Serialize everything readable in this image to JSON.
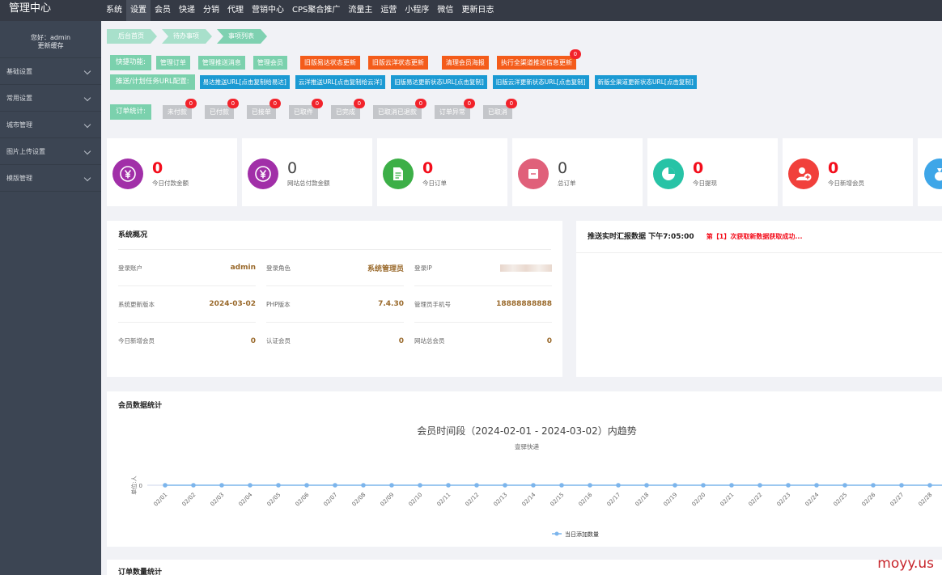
{
  "app": {
    "title": "管理中心"
  },
  "topnav": [
    "系统",
    "设置",
    "会员",
    "快递",
    "分销",
    "代理",
    "营销中心",
    "CPS聚合推广",
    "流量主",
    "运营",
    "小程序",
    "微信",
    "更新日志"
  ],
  "sidebar": {
    "greeting": "您好：admin",
    "refresh_cache": "更新缓存",
    "items": [
      "基础设置",
      "常用设置",
      "城市管理",
      "图片上传设置",
      "模版管理"
    ]
  },
  "breadcrumb": [
    "后台首页",
    "待办事项",
    "事项列表"
  ],
  "quick": {
    "label": "快捷功能:",
    "buttons": [
      "管理订单",
      "管理推送消息",
      "管理会员"
    ],
    "orange_buttons": [
      "旧版易达状态更新",
      "旧版云洋状态更新",
      "清理会员海报",
      "执行全渠道推送信息更新"
    ],
    "last_badge": "0"
  },
  "push_urls": {
    "label": "推送/计划任务URL配置:",
    "buttons": [
      "易达推送URL[点击复制给易达]",
      "云洋推送URL[点击复制给云洋]",
      "旧版易达更新状态URL[点击复制]",
      "旧版云洋更新状态URL[点击复制]",
      "新版全渠道更新状态URL[点击复制]"
    ]
  },
  "orders": {
    "label": "订单统计:",
    "items": [
      {
        "label": "未付款",
        "count": "0"
      },
      {
        "label": "已付款",
        "count": "0"
      },
      {
        "label": "已接单",
        "count": "0"
      },
      {
        "label": "已取件",
        "count": "0"
      },
      {
        "label": "已完成",
        "count": "0"
      },
      {
        "label": "已取消已退款",
        "count": "0"
      },
      {
        "label": "订单异常",
        "count": "0"
      },
      {
        "label": "已取消",
        "count": "0"
      }
    ]
  },
  "stats": [
    {
      "value": "0",
      "label": "今日付款金额",
      "icon": "yen-icon",
      "color": "#a12fa8",
      "red": true
    },
    {
      "value": "0",
      "label": "网站总付款金额",
      "icon": "yen-icon",
      "color": "#a12fa8",
      "red": false
    },
    {
      "value": "0",
      "label": "今日订单",
      "icon": "document-icon",
      "color": "#3caf47",
      "red": true
    },
    {
      "value": "0",
      "label": "总订单",
      "icon": "note-icon",
      "color": "#e0607a",
      "red": false
    },
    {
      "value": "0",
      "label": "今日提现",
      "icon": "pie-icon",
      "color": "#27c3a6",
      "red": true
    },
    {
      "value": "0",
      "label": "今日新增会员",
      "icon": "add-user-icon",
      "color": "#f1403b",
      "red": true
    }
  ],
  "system": {
    "title": "系统概况",
    "rows": [
      [
        {
          "k": "登录账户",
          "v": "admin"
        },
        {
          "k": "登录角色",
          "v": "系统管理员"
        },
        {
          "k": "登录IP",
          "v": ""
        }
      ],
      [
        {
          "k": "系统更新版本",
          "v": "2024-03-02"
        },
        {
          "k": "PHP版本",
          "v": "7.4.30"
        },
        {
          "k": "管理员手机号",
          "v": "18888888888"
        }
      ],
      [
        {
          "k": "今日新增会员",
          "v": "0"
        },
        {
          "k": "认证会员",
          "v": "0"
        },
        {
          "k": "网站总会员",
          "v": "0"
        }
      ]
    ]
  },
  "push_panel": {
    "title": "推送实时汇报数据 下午7:05:00",
    "message": "第【1】次获取新数据获取成功..."
  },
  "member_chart": {
    "panel_title": "会员数据统计"
  },
  "order_section": {
    "title": "订单数量统计"
  },
  "watermark": "moyy.us",
  "chart_data": {
    "type": "line",
    "title": "会员时间段（2024-02-01 - 2024-03-02）内趋势",
    "subtitle": "壹驿快递",
    "ylabel": "单位:人",
    "x": [
      "02/01",
      "02/02",
      "02/03",
      "02/04",
      "02/05",
      "02/06",
      "02/07",
      "02/08",
      "02/09",
      "02/10",
      "02/11",
      "02/12",
      "02/13",
      "02/14",
      "02/15",
      "02/16",
      "02/17",
      "02/18",
      "02/19",
      "02/20",
      "02/21",
      "02/22",
      "02/23",
      "02/24",
      "02/25",
      "02/26",
      "02/27",
      "02/28"
    ],
    "series": [
      {
        "name": "当日添加数量",
        "values": [
          0,
          0,
          0,
          0,
          0,
          0,
          0,
          0,
          0,
          0,
          0,
          0,
          0,
          0,
          0,
          0,
          0,
          0,
          0,
          0,
          0,
          0,
          0,
          0,
          0,
          0,
          0,
          0
        ]
      }
    ],
    "yticks": [
      "0"
    ],
    "legend": "bottom-center",
    "color": "#7cb5ec"
  }
}
